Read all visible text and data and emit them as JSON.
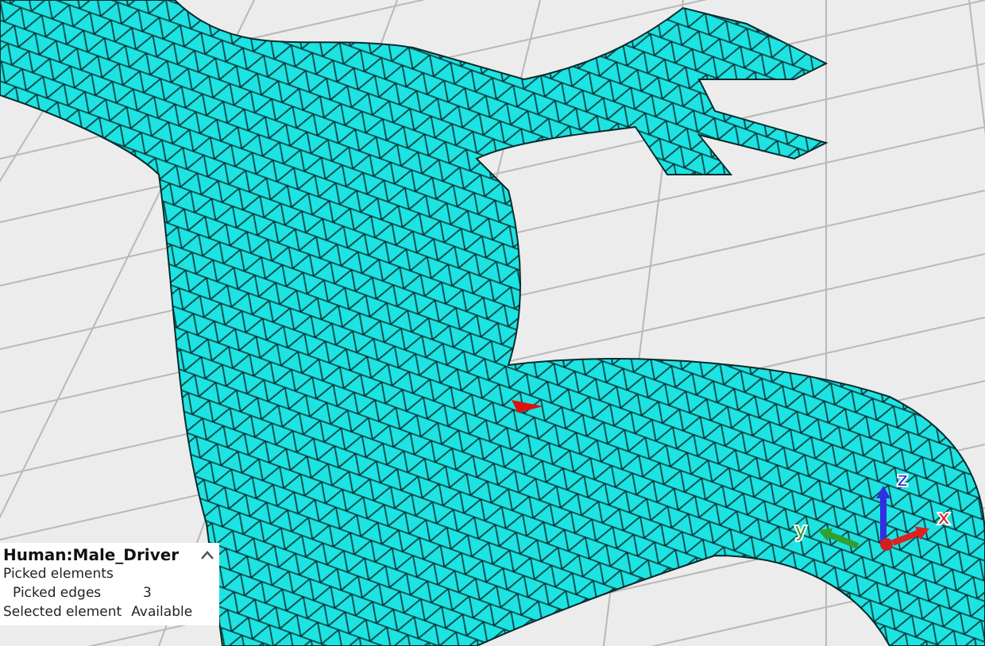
{
  "info_panel": {
    "title": "Human:Male_Driver",
    "collapsed": false,
    "rows": [
      {
        "label": "Picked elements",
        "value": "",
        "indented": false
      },
      {
        "label": "Picked edges",
        "value": "3",
        "indented": true
      },
      {
        "label": "Selected element",
        "value": "Available",
        "indented": false
      }
    ]
  },
  "axes": [
    {
      "label": "x",
      "color": "#e02020"
    },
    {
      "label": "y",
      "color": "#30a030"
    },
    {
      "label": "z",
      "color": "#3030e0"
    }
  ]
}
